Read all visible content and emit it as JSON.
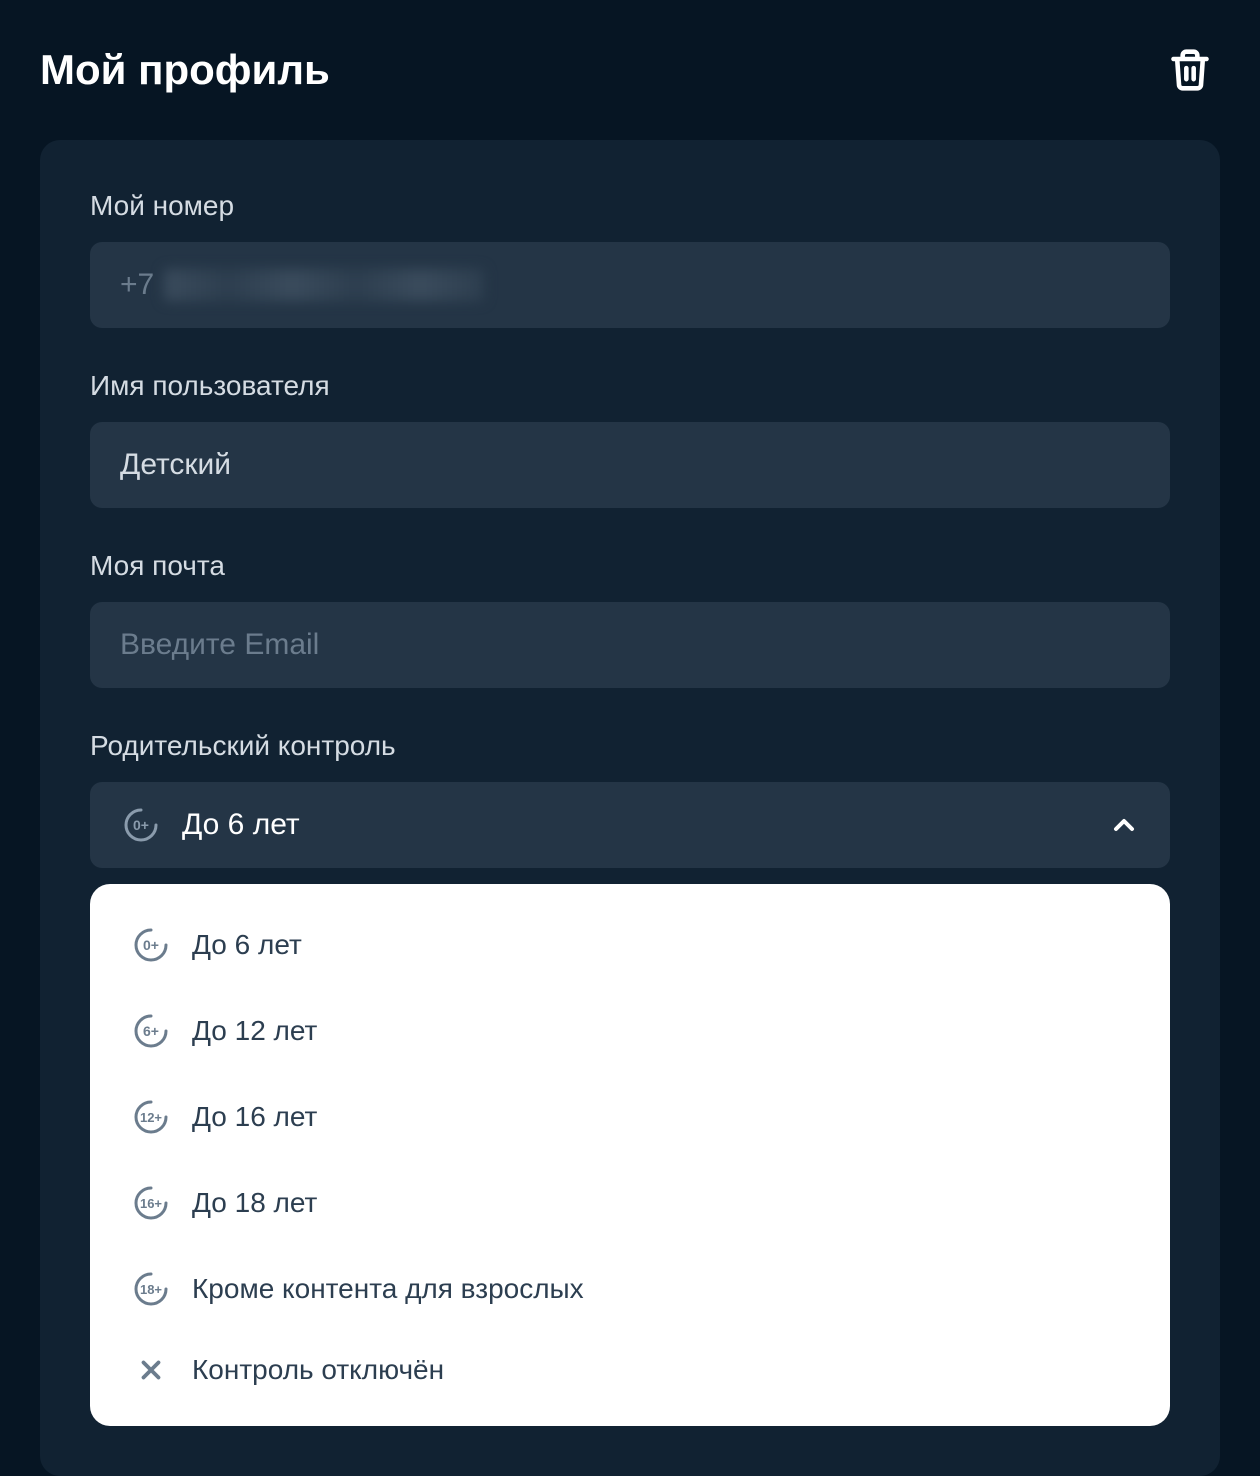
{
  "page": {
    "title": "Мой профиль"
  },
  "fields": {
    "phone": {
      "label": "Мой номер",
      "prefix": "+7"
    },
    "username": {
      "label": "Имя пользователя",
      "value": "Детский"
    },
    "email": {
      "label": "Моя почта",
      "placeholder": "Введите Email",
      "value": ""
    },
    "parental": {
      "label": "Родительский контроль",
      "selected": "До 6 лет",
      "selected_badge": "0+"
    }
  },
  "dropdown": {
    "options": [
      {
        "badge": "0+",
        "label": "До 6 лет"
      },
      {
        "badge": "6+",
        "label": "До 12 лет"
      },
      {
        "badge": "12+",
        "label": "До 16 лет"
      },
      {
        "badge": "16+",
        "label": "До 18 лет"
      },
      {
        "badge": "18+",
        "label": "Кроме контента для взрослых"
      },
      {
        "badge": "x",
        "label": "Контроль отключён"
      }
    ]
  }
}
